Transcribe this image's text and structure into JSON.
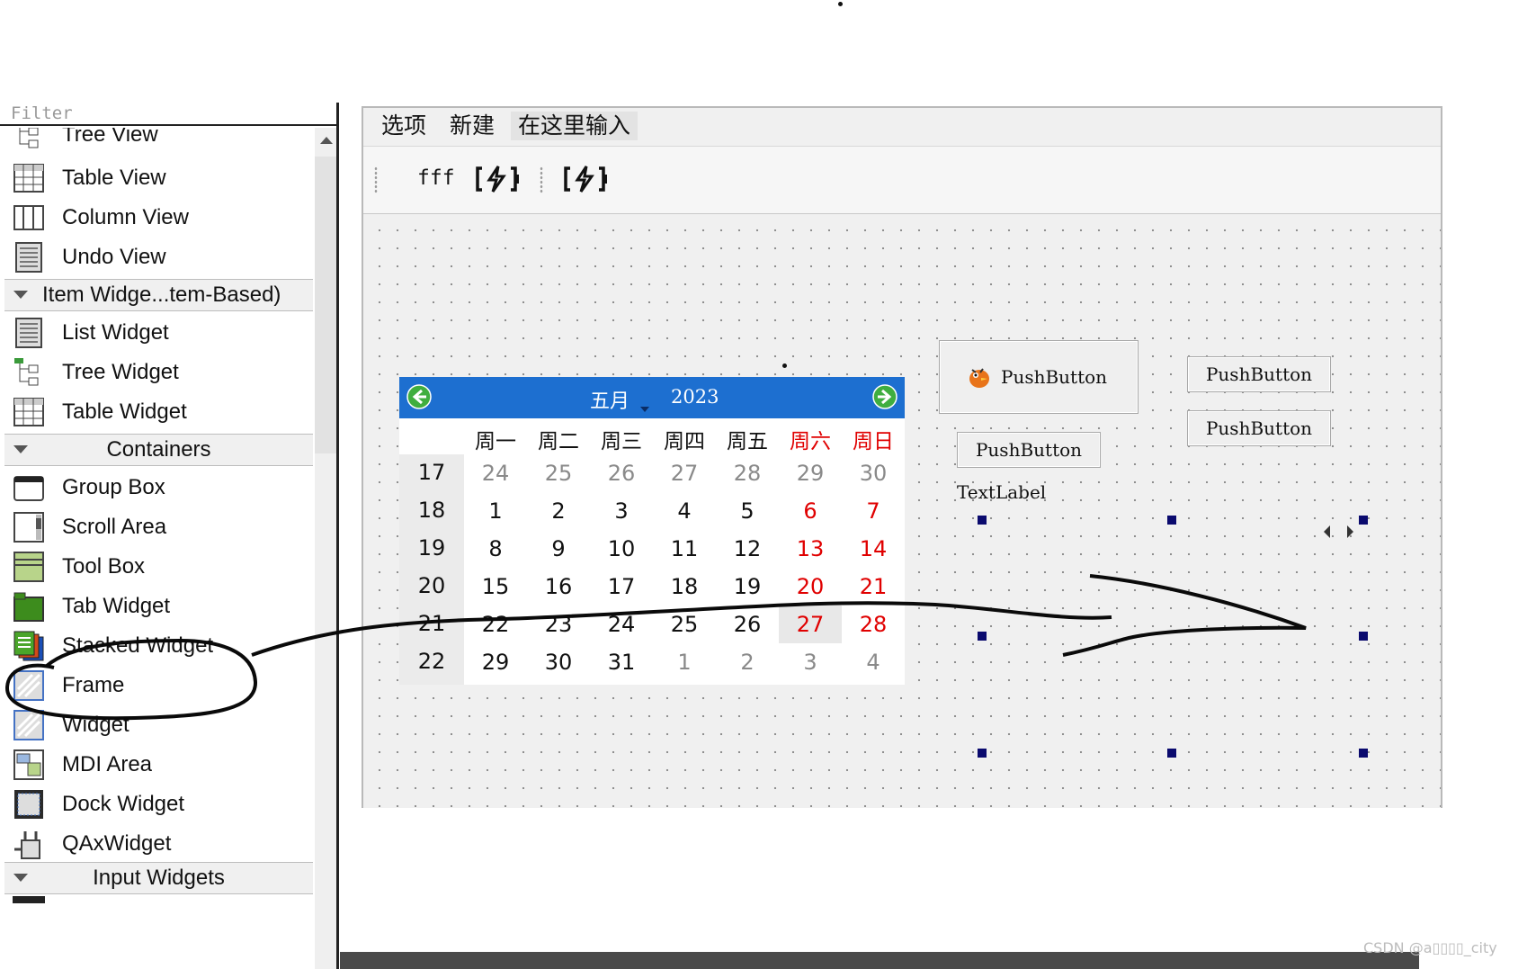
{
  "widget_box": {
    "filter_placeholder": "Filter",
    "items": [
      {
        "label": "Tree View",
        "icon": "tree-view-icon"
      },
      {
        "label": "Table View",
        "icon": "table-view-icon"
      },
      {
        "label": "Column View",
        "icon": "column-view-icon"
      },
      {
        "label": "Undo View",
        "icon": "undo-view-icon"
      },
      {
        "label": "List Widget",
        "icon": "list-widget-icon"
      },
      {
        "label": "Tree Widget",
        "icon": "tree-widget-icon"
      },
      {
        "label": "Table Widget",
        "icon": "table-widget-icon"
      },
      {
        "label": "Group Box",
        "icon": "group-box-icon"
      },
      {
        "label": "Scroll Area",
        "icon": "scroll-area-icon"
      },
      {
        "label": "Tool Box",
        "icon": "tool-box-icon"
      },
      {
        "label": "Tab Widget",
        "icon": "tab-widget-icon"
      },
      {
        "label": "Stacked Widget",
        "icon": "stacked-widget-icon"
      },
      {
        "label": "Frame",
        "icon": "frame-icon"
      },
      {
        "label": "Widget",
        "icon": "widget-icon"
      },
      {
        "label": "MDI Area",
        "icon": "mdi-area-icon"
      },
      {
        "label": "Dock Widget",
        "icon": "dock-widget-icon"
      },
      {
        "label": "QAxWidget",
        "icon": "qaxwidget-icon"
      }
    ],
    "categories": {
      "item_widgets": "Item Widge...tem-Based)",
      "containers": "Containers",
      "input_widgets": "Input Widgets"
    }
  },
  "form": {
    "menu": {
      "options": "选项",
      "new": "新建",
      "type_here": "在这里输入"
    },
    "toolbar": {
      "action_text": "fff",
      "icons": [
        "battery-charging-icon",
        "battery-charging-icon"
      ]
    },
    "calendar": {
      "month": "五月",
      "year": "2023",
      "day_headers": [
        "周一",
        "周二",
        "周三",
        "周四",
        "周五",
        "周六",
        "周日"
      ],
      "weekend_color": "#e00000",
      "nav_color": "#1d6fd0",
      "week_numbers": [
        "17",
        "18",
        "19",
        "20",
        "21",
        "22"
      ],
      "days": [
        [
          "24",
          "25",
          "26",
          "27",
          "28",
          "29",
          "30"
        ],
        [
          "1",
          "2",
          "3",
          "4",
          "5",
          "6",
          "7"
        ],
        [
          "8",
          "9",
          "10",
          "11",
          "12",
          "13",
          "14"
        ],
        [
          "15",
          "16",
          "17",
          "18",
          "19",
          "20",
          "21"
        ],
        [
          "22",
          "23",
          "24",
          "25",
          "26",
          "27",
          "28"
        ],
        [
          "29",
          "30",
          "31",
          "1",
          "2",
          "3",
          "4"
        ]
      ],
      "selected_day": "27"
    },
    "buttons": {
      "icon_push": "PushButton",
      "push_2": "PushButton",
      "push_3": "PushButton",
      "push_4": "PushButton"
    },
    "text_label": "TextLabel",
    "selection_handle_color": "#0a0a6e"
  },
  "watermark": "CSDN @a▯▯▯▯_city"
}
